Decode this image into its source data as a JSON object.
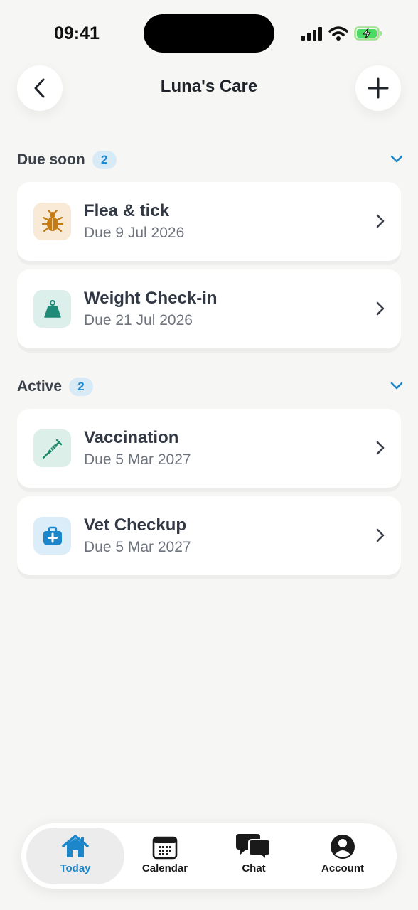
{
  "status_bar": {
    "time": "09:41"
  },
  "header": {
    "title": "Luna's Care"
  },
  "sections": [
    {
      "title": "Due soon",
      "count": "2",
      "items": [
        {
          "title": "Flea & tick",
          "subtitle": "Due 9 Jul 2026",
          "icon": "bug-icon",
          "icon_bg": "#f8ead6",
          "icon_color": "#c47b14"
        },
        {
          "title": "Weight Check-in",
          "subtitle": "Due 21 Jul 2026",
          "icon": "weight-icon",
          "icon_bg": "#dcefeb",
          "icon_color": "#1f8a78"
        }
      ]
    },
    {
      "title": "Active",
      "count": "2",
      "items": [
        {
          "title": "Vaccination",
          "subtitle": "Due 5 Mar 2027",
          "icon": "syringe-icon",
          "icon_bg": "#dcefe8",
          "icon_color": "#1f8a6c"
        },
        {
          "title": "Vet Checkup",
          "subtitle": "Due 5 Mar 2027",
          "icon": "medical-kit-icon",
          "icon_bg": "#dcedfa",
          "icon_color": "#1b86c9"
        }
      ]
    }
  ],
  "tab_bar": {
    "active": "Today",
    "tabs": [
      {
        "label": "Today",
        "icon": "home-icon"
      },
      {
        "label": "Calendar",
        "icon": "calendar-icon"
      },
      {
        "label": "Chat",
        "icon": "chat-icon"
      },
      {
        "label": "Account",
        "icon": "account-icon"
      }
    ]
  },
  "colors": {
    "accent": "#1b86c9",
    "background": "#f6f6f4"
  }
}
